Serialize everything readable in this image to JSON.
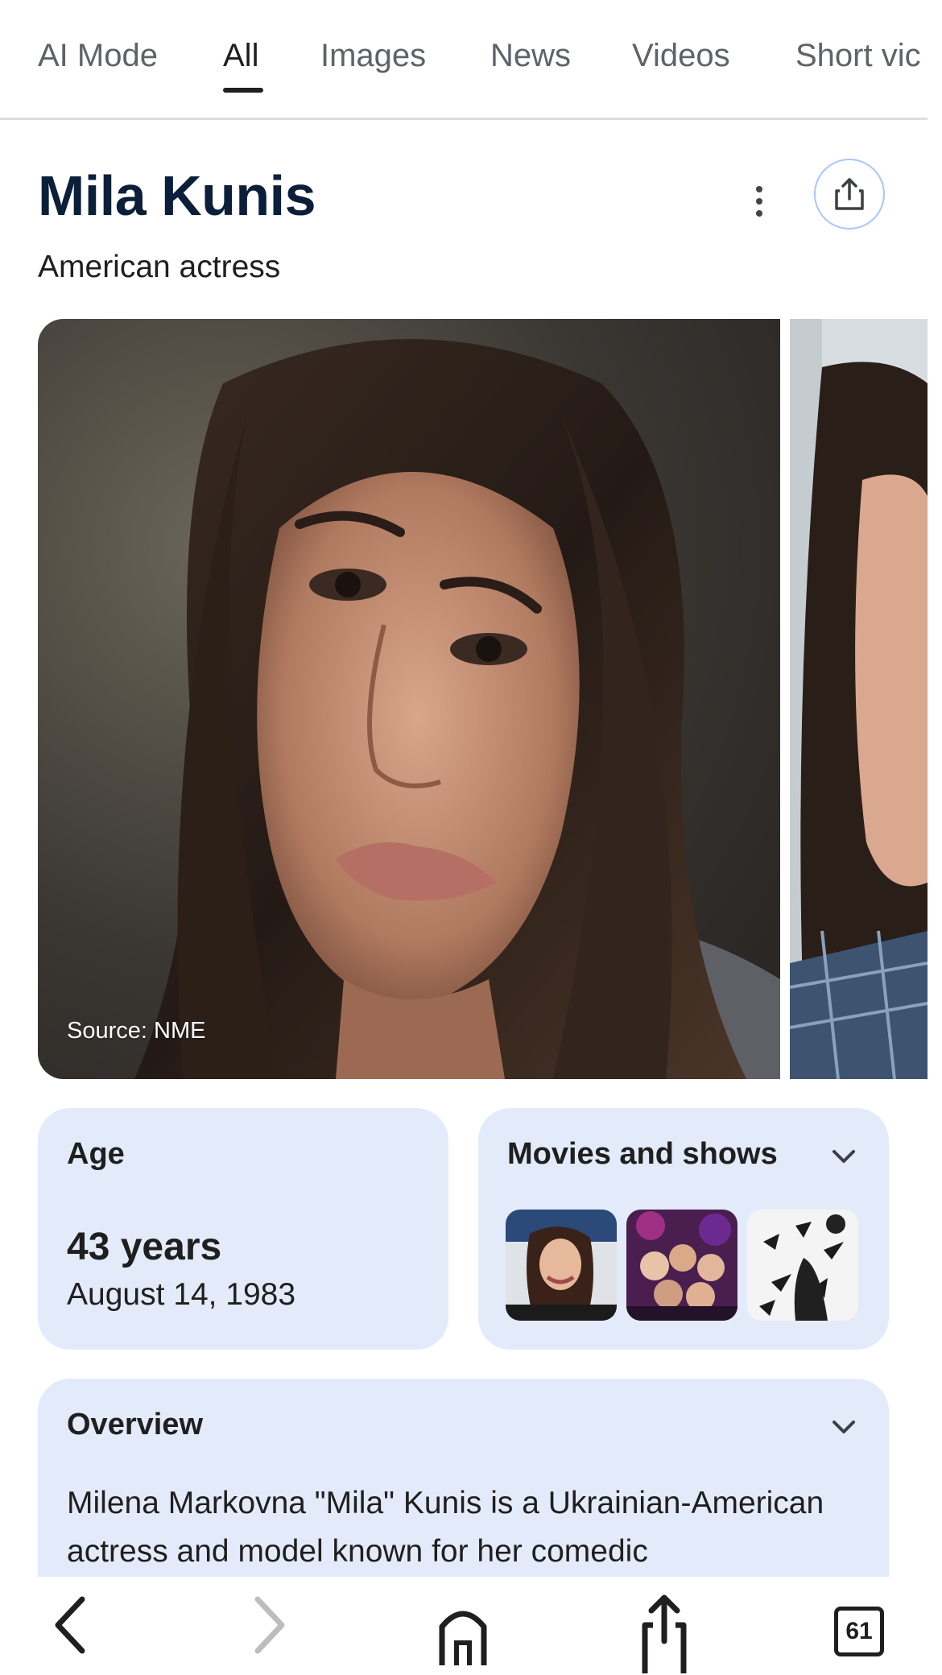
{
  "tabs": [
    {
      "label": "AI Mode"
    },
    {
      "label": "All"
    },
    {
      "label": "Images"
    },
    {
      "label": "News"
    },
    {
      "label": "Videos"
    },
    {
      "label": "Short vic"
    }
  ],
  "active_tab": "All",
  "entity": {
    "title": "Mila Kunis",
    "subtitle": "American actress"
  },
  "photo": {
    "source": "Source: NME"
  },
  "age_card": {
    "label": "Age",
    "value": "43 years",
    "date": "August 14, 1983"
  },
  "movies_card": {
    "label": "Movies and shows"
  },
  "overview": {
    "label": "Overview",
    "text": "Milena Markovna \"Mila\" Kunis is a Ukrainian-American actress and model known for her comedic"
  },
  "bottom_bar": {
    "tab_count": "61",
    "icons": [
      "back-icon",
      "forward-icon",
      "home-icon",
      "share-icon",
      "tabs-icon"
    ]
  },
  "colors": {
    "card_bg": "#e3ebfb",
    "title": "#0b1f3a",
    "share_ring": "#a8c7fa"
  }
}
